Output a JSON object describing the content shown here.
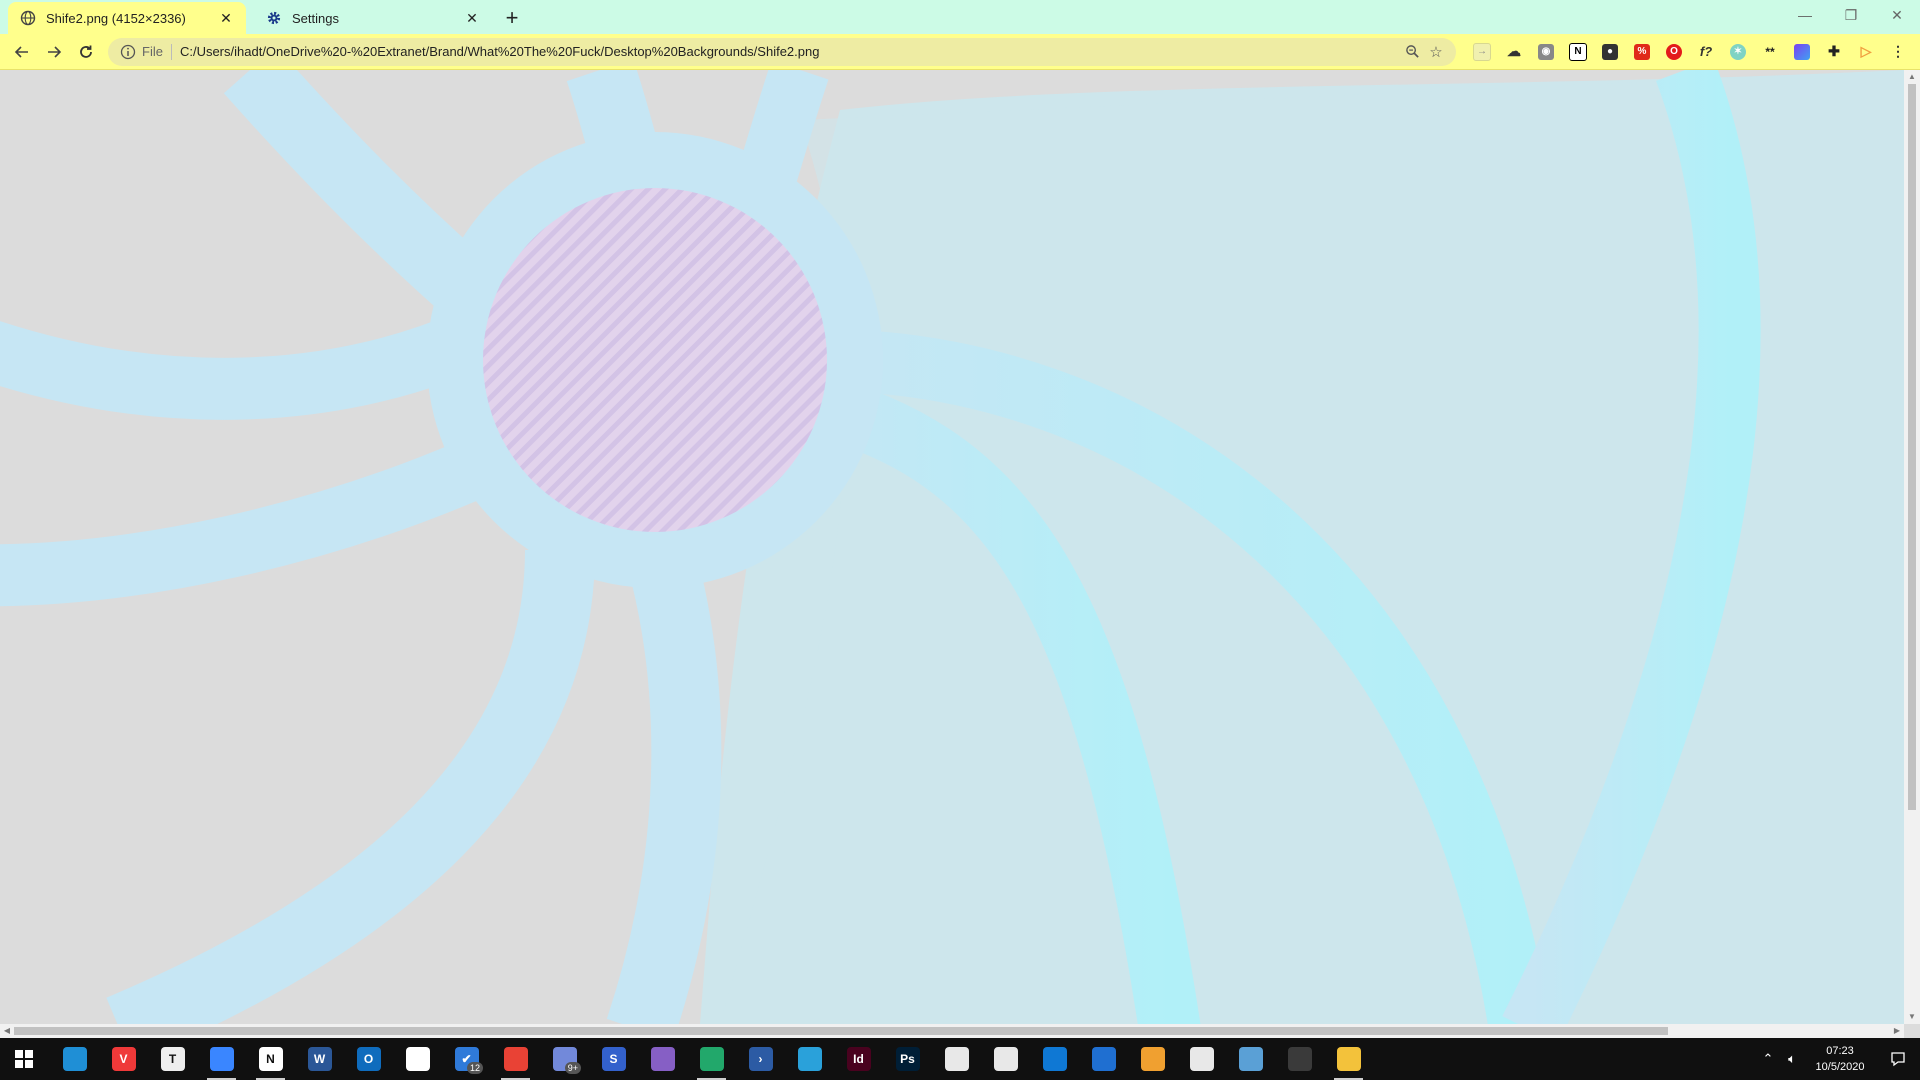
{
  "browser": {
    "tabs": [
      {
        "title": "Shife2.png (4152×2336)",
        "favicon": "globe-icon",
        "active": true
      },
      {
        "title": "Settings",
        "favicon": "gear-icon",
        "active": false
      }
    ],
    "address": {
      "scheme_label": "File",
      "url": "C:/Users/ihadt/OneDrive%20-%20Extranet/Brand/What%20The%20Fuck/Desktop%20Backgrounds/Shife2.png"
    },
    "extensions": [
      "zoom-icon",
      "star-icon",
      "share-icon",
      "cloud-icon",
      "camera-icon",
      "notion-icon",
      "group-icon",
      "percent-icon",
      "opera-icon",
      "function-icon",
      "globe-icon",
      "asterisk-icon",
      "square-icon",
      "puzzle-icon",
      "send-icon",
      "more-icon"
    ],
    "colors": {
      "tabstrip": "#ccfbe6",
      "toolbar": "#ffff8c",
      "omnibox": "#eeeca3"
    }
  },
  "image": {
    "colors": {
      "background": "#dcdcdc",
      "band": "#c6e6f4",
      "band_bright": "#b1f0f8",
      "circle": "#e2d3ec",
      "stripe": "#d3c3e6",
      "lower_right": "#cde6ec"
    }
  },
  "taskbar": {
    "apps": [
      {
        "name": "edge-dev-icon",
        "label": "",
        "color": "#1f8fd6",
        "running": false
      },
      {
        "name": "vivaldi-icon",
        "label": "V",
        "color": "#ef3939",
        "running": false
      },
      {
        "name": "typora-icon",
        "label": "T",
        "color": "#eeeeee",
        "running": false
      },
      {
        "name": "firefox-icon",
        "label": "",
        "color": "#3a86ff",
        "running": true
      },
      {
        "name": "notion-icon",
        "label": "N",
        "color": "#ffffff",
        "running": true
      },
      {
        "name": "word-icon",
        "label": "W",
        "color": "#2b5797",
        "running": false
      },
      {
        "name": "outlook-icon",
        "label": "O",
        "color": "#0f6cbd",
        "running": false
      },
      {
        "name": "bitwarden-icon",
        "label": "",
        "color": "#ffffff",
        "running": false
      },
      {
        "name": "todo-icon",
        "label": "✔",
        "color": "#2f7ad9",
        "running": false,
        "badge": "12"
      },
      {
        "name": "chrome-icon",
        "label": "",
        "color": "#e94235",
        "running": true
      },
      {
        "name": "discord-icon",
        "label": "",
        "color": "#7289da",
        "running": false,
        "badge": "9+"
      },
      {
        "name": "simplenote-icon",
        "label": "S",
        "color": "#3361cc",
        "running": false
      },
      {
        "name": "visual-studio-icon",
        "label": "",
        "color": "#865fc5",
        "running": false
      },
      {
        "name": "vscode-icon",
        "label": "",
        "color": "#22a86b",
        "running": true
      },
      {
        "name": "powershell-icon",
        "label": "›",
        "color": "#2c5ba4",
        "running": false
      },
      {
        "name": "telegram-icon",
        "label": "",
        "color": "#2aa1da",
        "running": false
      },
      {
        "name": "indesign-icon",
        "label": "Id",
        "color": "#49021f",
        "running": false
      },
      {
        "name": "photoshop-icon",
        "label": "Ps",
        "color": "#001e36",
        "running": false
      },
      {
        "name": "compass-icon",
        "label": "",
        "color": "#e8e8e8",
        "running": false
      },
      {
        "name": "news-icon",
        "label": "",
        "color": "#e8e8e8",
        "running": false
      },
      {
        "name": "onedrive-icon",
        "label": "",
        "color": "#0f78d4",
        "running": false
      },
      {
        "name": "mail-icon",
        "label": "",
        "color": "#1f6fd1",
        "running": false
      },
      {
        "name": "ball-icon",
        "label": "",
        "color": "#f0a030",
        "running": false
      },
      {
        "name": "slack-icon",
        "label": "",
        "color": "#e8e8e8",
        "running": false
      },
      {
        "name": "podcast-icon",
        "label": "",
        "color": "#5aa0d6",
        "running": false
      },
      {
        "name": "terminal-icon",
        "label": "",
        "color": "#3a3a3a",
        "running": false
      },
      {
        "name": "file-explorer-icon",
        "label": "",
        "color": "#f3c23b",
        "running": true
      }
    ],
    "clock": {
      "time": "07:23",
      "date": "10/5/2020"
    }
  }
}
